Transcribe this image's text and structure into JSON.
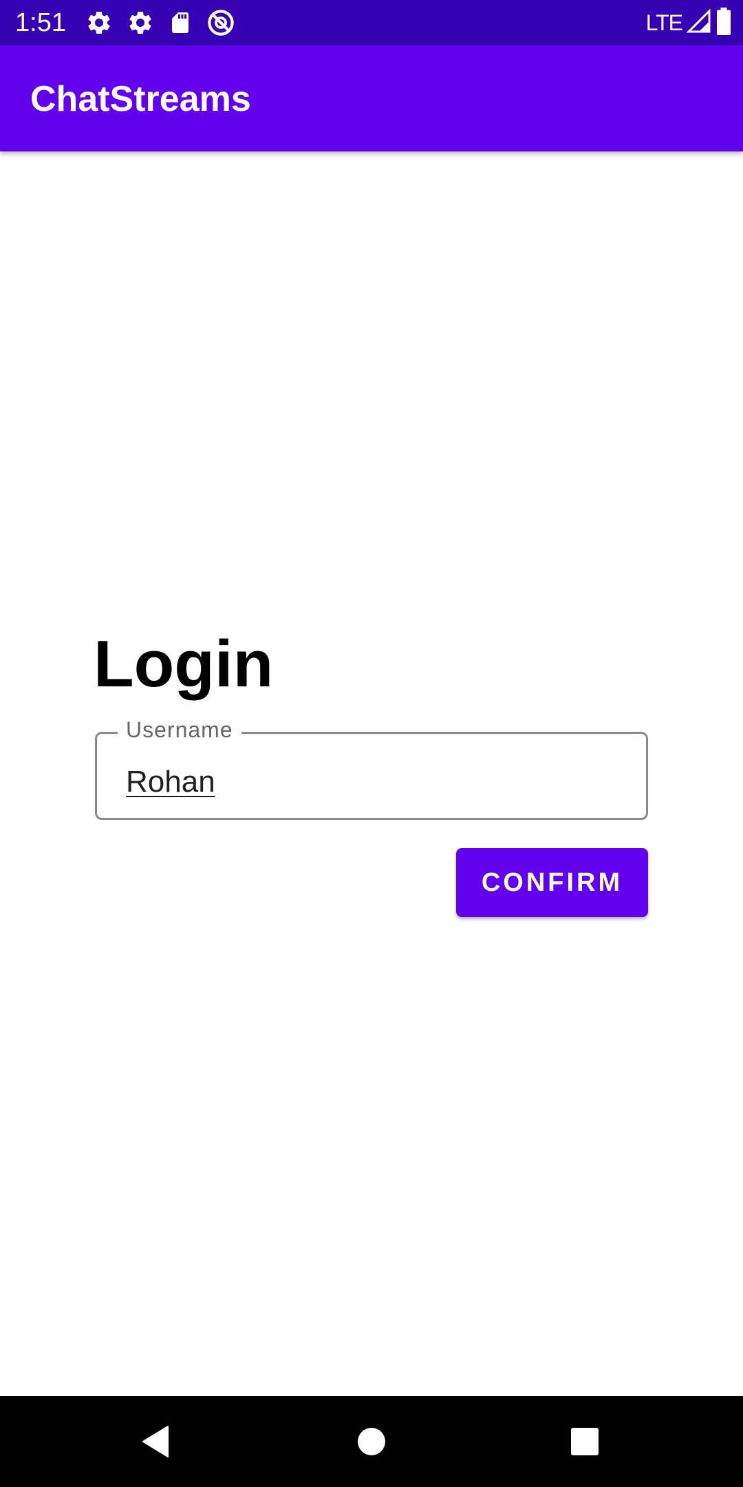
{
  "status_bar": {
    "time": "1:51",
    "network": "LTE",
    "icons_left": [
      "settings-gear-icon",
      "settings-gear-icon",
      "sd-card-icon",
      "no-tracking-icon"
    ],
    "icons_right": [
      "signal-icon",
      "battery-icon"
    ]
  },
  "app_bar": {
    "title": "ChatStreams"
  },
  "login": {
    "heading": "Login",
    "username_field": {
      "label": "Username",
      "value": "Rohan"
    },
    "confirm_label": "CONFIRM"
  },
  "nav_bar": {
    "buttons": [
      "back",
      "home",
      "recents"
    ]
  },
  "colors": {
    "status_bar": "#3700b3",
    "primary": "#6200ee",
    "on_primary": "#ffffff",
    "field_border": "#8a8a8a",
    "nav_bar": "#000000"
  }
}
